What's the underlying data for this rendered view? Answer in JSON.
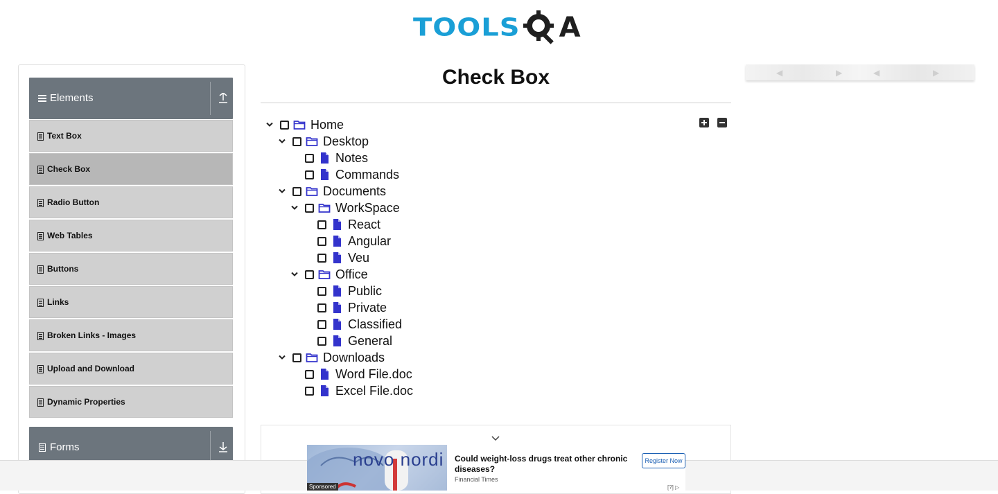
{
  "header": {
    "logo_text": "TOOLS",
    "logo_suffix": "A"
  },
  "sidebar": {
    "groups": [
      {
        "label": "Elements",
        "expanded": true
      },
      {
        "label": "Forms",
        "expanded": false
      }
    ],
    "items": [
      {
        "label": "Text Box",
        "active": false
      },
      {
        "label": "Check Box",
        "active": true
      },
      {
        "label": "Radio Button",
        "active": false
      },
      {
        "label": "Web Tables",
        "active": false
      },
      {
        "label": "Buttons",
        "active": false
      },
      {
        "label": "Links",
        "active": false
      },
      {
        "label": "Broken Links - Images",
        "active": false
      },
      {
        "label": "Upload and Download",
        "active": false
      },
      {
        "label": "Dynamic Properties",
        "active": false
      }
    ]
  },
  "main": {
    "title": "Check Box",
    "tree": [
      {
        "label": "Home",
        "type": "folder",
        "depth": 0,
        "expanded": true
      },
      {
        "label": "Desktop",
        "type": "folder",
        "depth": 1,
        "expanded": true
      },
      {
        "label": "Notes",
        "type": "file",
        "depth": 2
      },
      {
        "label": "Commands",
        "type": "file",
        "depth": 2
      },
      {
        "label": "Documents",
        "type": "folder",
        "depth": 1,
        "expanded": true
      },
      {
        "label": "WorkSpace",
        "type": "folder",
        "depth": 2,
        "expanded": true
      },
      {
        "label": "React",
        "type": "file",
        "depth": 3
      },
      {
        "label": "Angular",
        "type": "file",
        "depth": 3
      },
      {
        "label": "Veu",
        "type": "file",
        "depth": 3
      },
      {
        "label": "Office",
        "type": "folder",
        "depth": 2,
        "expanded": true
      },
      {
        "label": "Public",
        "type": "file",
        "depth": 3
      },
      {
        "label": "Private",
        "type": "file",
        "depth": 3
      },
      {
        "label": "Classified",
        "type": "file",
        "depth": 3
      },
      {
        "label": "General",
        "type": "file",
        "depth": 3
      },
      {
        "label": "Downloads",
        "type": "folder",
        "depth": 1,
        "expanded": true
      },
      {
        "label": "Word File.doc",
        "type": "file",
        "depth": 2
      },
      {
        "label": "Excel File.doc",
        "type": "file",
        "depth": 2
      }
    ]
  },
  "ad": {
    "image_text": "novo nordi",
    "sponsored": "Sponsored",
    "headline": "Could weight-loss drugs treat other chronic diseases?",
    "source": "Financial Times",
    "cta": "Register Now",
    "choice": "[?]"
  },
  "colors": {
    "accent": "#3333cc",
    "group_header": "#6c757d",
    "menu_item": "#d0d0d0",
    "menu_active": "#b7b7b7",
    "logo_blue": "#1a9fd6"
  }
}
